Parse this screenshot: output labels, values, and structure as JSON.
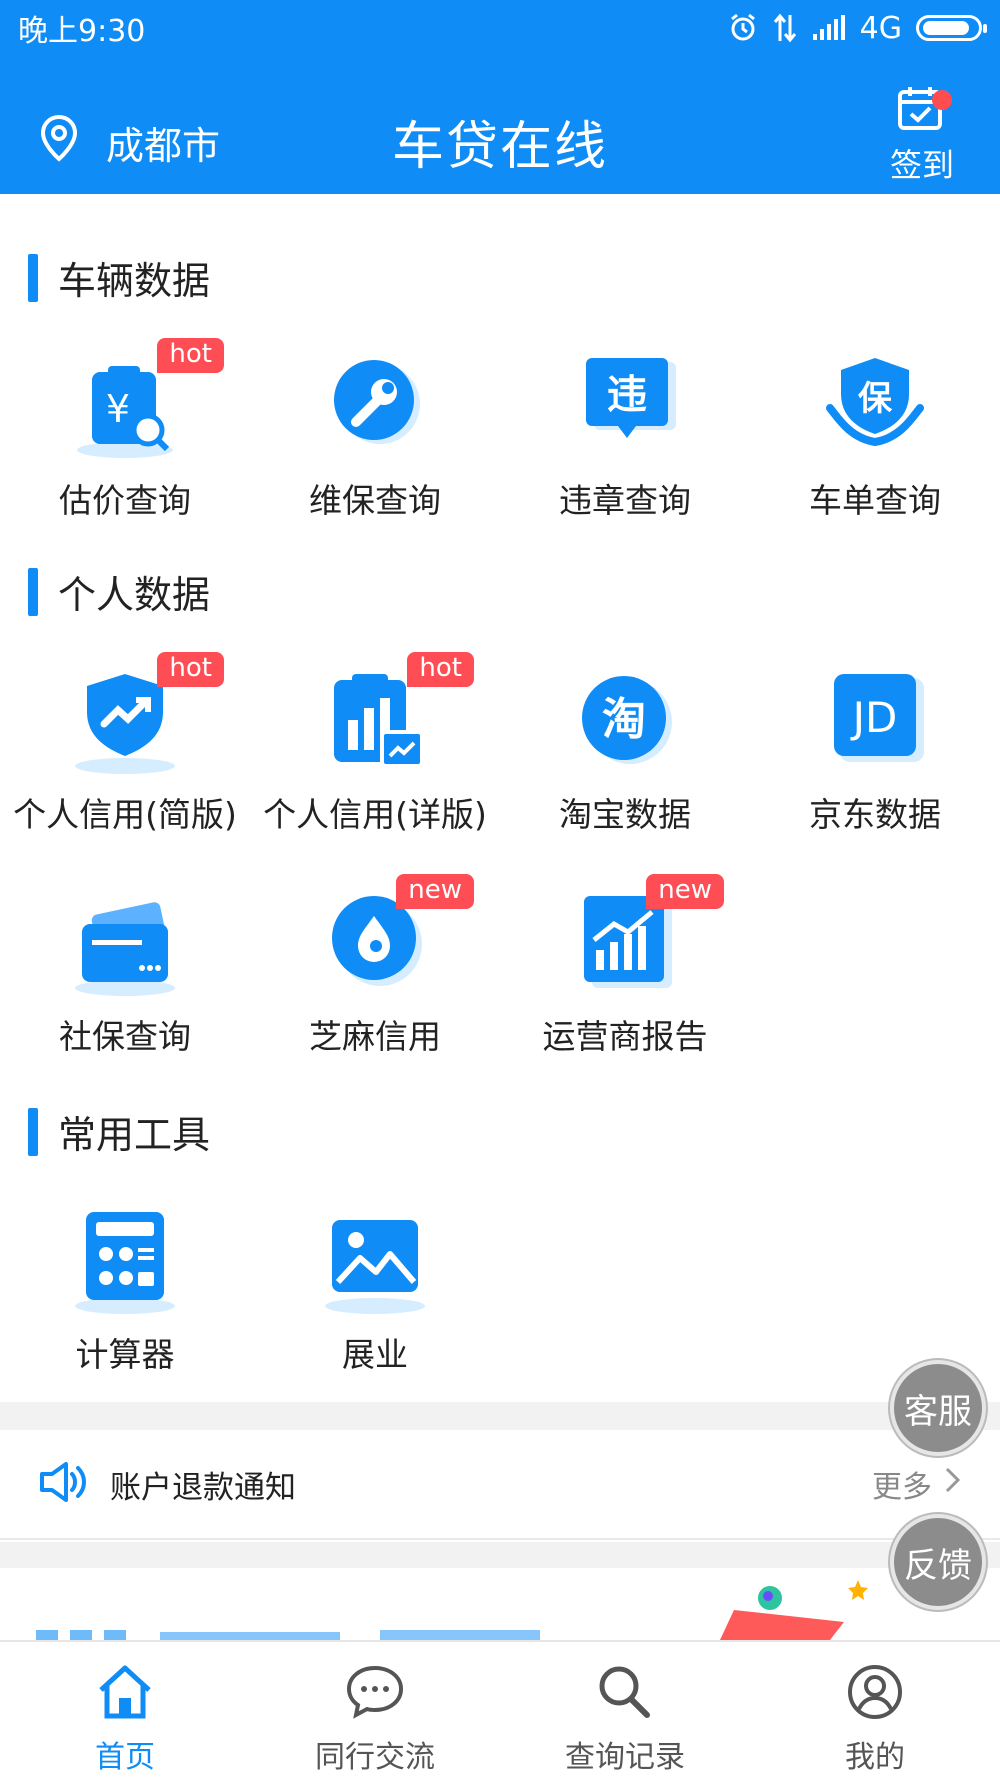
{
  "status_bar": {
    "time": "晚上9:30",
    "network": "4G"
  },
  "header": {
    "city": "成都市",
    "title": "车贷在线",
    "checkin_label": "签到"
  },
  "sections": {
    "vehicle": {
      "title": "车辆数据",
      "items": [
        {
          "label": "估价查询",
          "badge": "hot",
          "icon": "valuation-icon"
        },
        {
          "label": "维保查询",
          "badge": "",
          "icon": "wrench-icon"
        },
        {
          "label": "违章查询",
          "badge": "",
          "icon": "violation-icon",
          "glyph": "违"
        },
        {
          "label": "车单查询",
          "badge": "",
          "icon": "insurance-icon",
          "glyph": "保"
        }
      ]
    },
    "personal": {
      "title": "个人数据",
      "items": [
        {
          "label": "个人信用(简版)",
          "badge": "hot",
          "icon": "shield-chart-icon"
        },
        {
          "label": "个人信用(详版)",
          "badge": "hot",
          "icon": "bar-chart-icon"
        },
        {
          "label": "淘宝数据",
          "badge": "",
          "icon": "taobao-icon",
          "glyph": "淘"
        },
        {
          "label": "京东数据",
          "badge": "",
          "icon": "jd-icon",
          "glyph": "JD"
        },
        {
          "label": "社保查询",
          "badge": "",
          "icon": "card-icon"
        },
        {
          "label": "芝麻信用",
          "badge": "new",
          "icon": "sesame-icon"
        },
        {
          "label": "运营商报告",
          "badge": "new",
          "icon": "trend-icon"
        }
      ]
    },
    "tools": {
      "title": "常用工具",
      "items": [
        {
          "label": "计算器",
          "icon": "calculator-icon"
        },
        {
          "label": "展业",
          "icon": "image-icon"
        }
      ]
    }
  },
  "notice": {
    "text": "账户退款通知",
    "more": "更多"
  },
  "float_buttons": {
    "service": "客服",
    "feedback": "反馈"
  },
  "tabbar": [
    {
      "label": "首页",
      "active": true
    },
    {
      "label": "同行交流",
      "active": false
    },
    {
      "label": "查询记录",
      "active": false
    },
    {
      "label": "我的",
      "active": false
    }
  ],
  "colors": {
    "brand": "#0f8cf5",
    "badge": "#ff4d55"
  }
}
